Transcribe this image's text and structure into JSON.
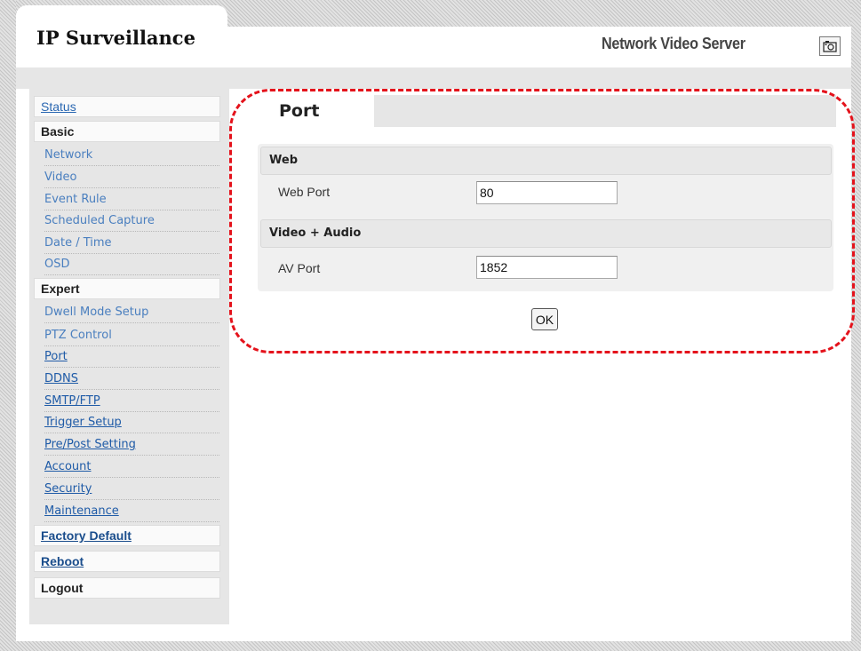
{
  "header": {
    "app_title": "IP Surveillance",
    "product_name": "Network Video Server",
    "snapshot_icon": "camera-icon"
  },
  "sidebar": {
    "status": "Status",
    "basic": {
      "label": "Basic",
      "items": [
        "Network",
        "Video",
        "Event Rule",
        "Scheduled Capture",
        "Date / Time",
        "OSD"
      ]
    },
    "expert": {
      "label": "Expert",
      "items": [
        "Dwell Mode Setup",
        "PTZ Control",
        "Port",
        "DDNS",
        "SMTP/FTP",
        "Trigger Setup",
        "Pre/Post Setting",
        "Account",
        "Security",
        "Maintenance"
      ]
    },
    "factory_default": "Factory Default",
    "reboot": "Reboot",
    "logout": "Logout"
  },
  "main": {
    "tab": "Port",
    "web": {
      "title": "Web",
      "port_label": "Web Port",
      "port_value": "80"
    },
    "av": {
      "title": "Video + Audio",
      "port_label": "AV Port",
      "port_value": "1852"
    },
    "ok": "OK"
  },
  "colors": {
    "highlight": "#e4121b",
    "link": "#1f5ba7",
    "panel": "#f0f0f0"
  }
}
